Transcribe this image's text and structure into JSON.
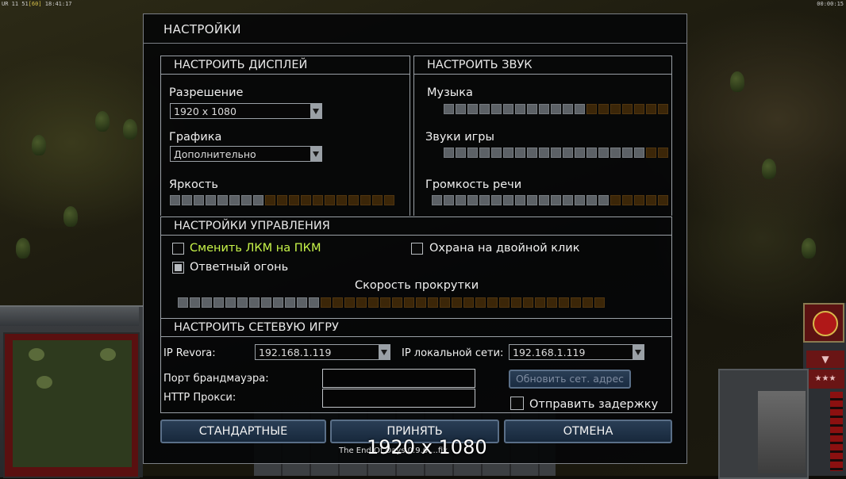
{
  "hud": {
    "top_left_prefix": "UR 11 51",
    "top_left_fps": "[60]",
    "top_left_clock": "18:41:17",
    "top_right": "00:00:15",
    "right_arrow_icon": "chevron-down-icon",
    "right_stars": "★★★"
  },
  "dialog": {
    "title": "НАСТРОЙКИ",
    "display": {
      "header": "НАСТРОИТЬ ДИСПЛЕЙ",
      "resolution_label": "Разрешение",
      "resolution_value": "1920 x 1080",
      "graphics_label": "Графика",
      "graphics_value": "Дополнительно",
      "brightness_label": "Яркость",
      "brightness_level": 0.42
    },
    "sound": {
      "header": "НАСТРОИТЬ ЗВУК",
      "music_label": "Музыка",
      "music_level": 0.63,
      "effects_label": "Звуки игры",
      "effects_level": 0.88,
      "voice_label": "Громкость речи",
      "voice_level": 0.75
    },
    "controls": {
      "header": "НАСТРОЙКИ УПРАВЛЕНИЯ",
      "swap_mouse_label": "Сменить ЛКМ на ПКМ",
      "swap_mouse_checked": false,
      "double_click_guard_label": "Охрана на двойной клик",
      "double_click_guard_checked": false,
      "return_fire_label": "Ответный огонь",
      "return_fire_checked": true,
      "scroll_speed_label": "Скорость прокрутки",
      "scroll_speed_level": 0.32
    },
    "network": {
      "header": "НАСТРОИТЬ СЕТЕВУЮ ИГРУ",
      "revora_label": "IP Revora:",
      "revora_value": "192.168.1.119",
      "lan_label": "IP локальной сети:",
      "lan_value": "192.168.1.119",
      "firewall_port_label": "Порт брандмауэра:",
      "firewall_port_value": "",
      "http_proxy_label": "HTTP Прокси:",
      "http_proxy_value": "",
      "refresh_button": "Обновить сет. адрес",
      "send_delay_label": "Отправить задержку",
      "send_delay_checked": false
    },
    "buttons": {
      "defaults": "СТАНДАРТНЫЕ",
      "accept": "ПРИНЯТЬ",
      "cancel": "ОТМЕНА"
    }
  },
  "footer": {
    "version_text": "The End Of Days 0.9.6 ...fix",
    "resolution_overlay": "1920 x 1080"
  }
}
